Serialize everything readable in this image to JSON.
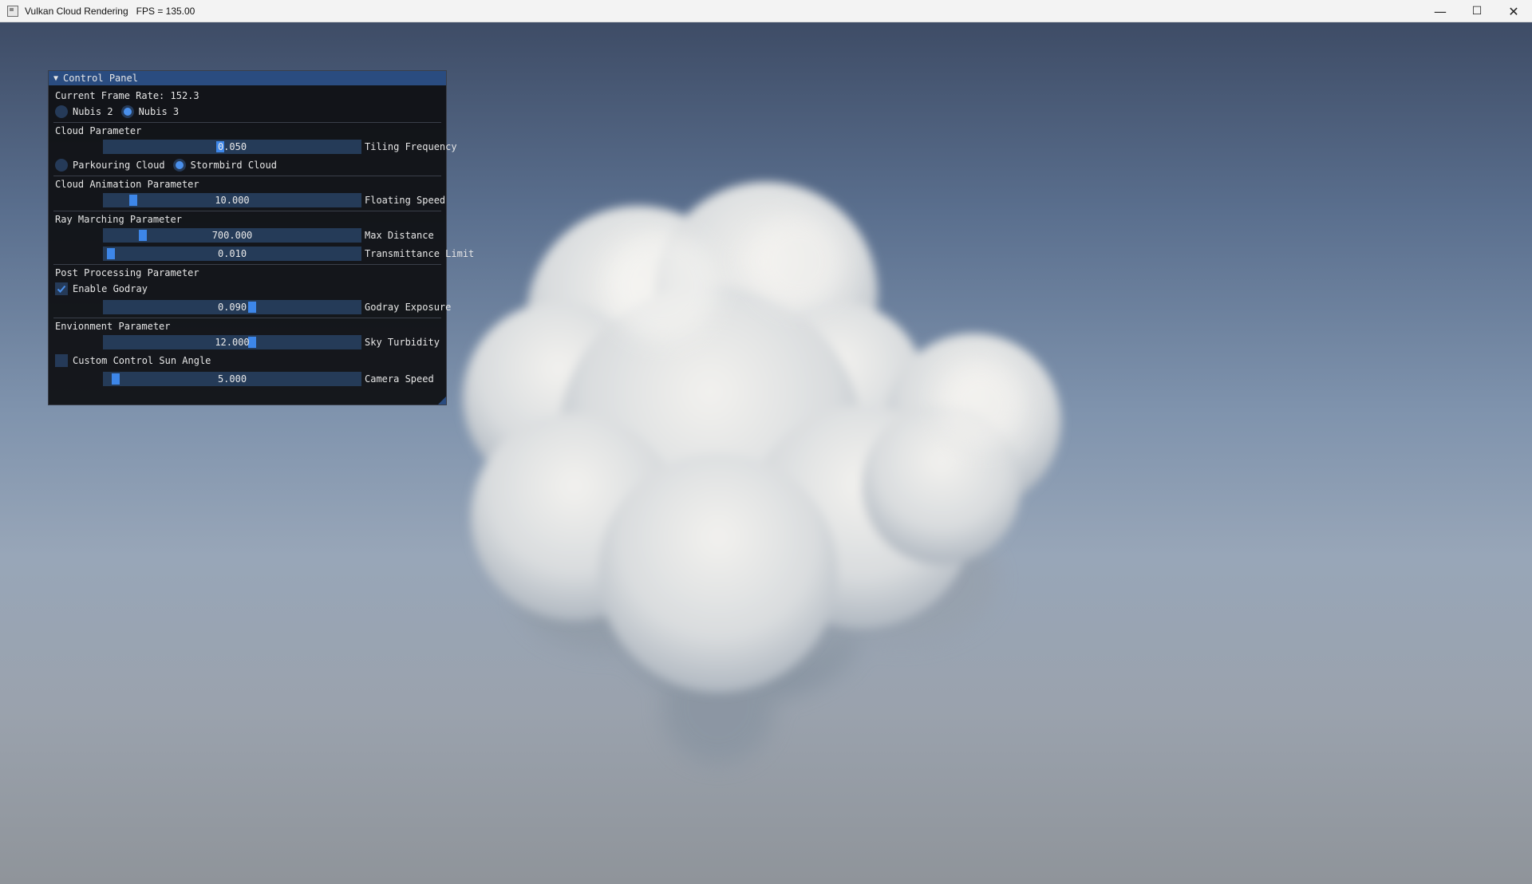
{
  "window": {
    "title": "Vulkan Cloud Rendering   FPS = 135.00",
    "minimize": "—",
    "maximize": "☐",
    "close": "✕"
  },
  "panel": {
    "header": "Control Panel",
    "collapse_icon": "▼",
    "frame_rate": "Current Frame Rate: 152.3",
    "nubis": {
      "options": [
        "Nubis 2",
        "Nubis 3"
      ],
      "selected": "Nubis 3"
    },
    "cloud_section": "Cloud Parameter",
    "tiling_frequency": {
      "value": "0.050",
      "label": "Tiling Frequency",
      "fraction": 0.45
    },
    "cloud_type": {
      "options": [
        "Parkouring Cloud",
        "Stormbird Cloud"
      ],
      "selected": "Stormbird Cloud"
    },
    "animation_section": "Cloud Animation Parameter",
    "floating_speed": {
      "value": "10.000",
      "label": "Floating Speed",
      "fraction": 0.1
    },
    "raymarch_section": "Ray Marching Parameter",
    "max_distance": {
      "value": "700.000",
      "label": "Max Distance",
      "fraction": 0.14
    },
    "transmittance_limit": {
      "value": "0.010",
      "label": "Transmittance Limit",
      "fraction": 0.01
    },
    "post_section": "Post Processing Parameter",
    "enable_godray": {
      "label": "Enable Godray",
      "checked": true
    },
    "godray_exposure": {
      "value": "0.090",
      "label": "Godray Exposure",
      "fraction": 0.58
    },
    "environment_section": "Envionment Parameter",
    "sky_turbidity": {
      "value": "12.000",
      "label": "Sky Turbidity",
      "fraction": 0.58
    },
    "custom_sun": {
      "label": "Custom Control Sun Angle",
      "checked": false
    },
    "camera_speed": {
      "value": "5.000",
      "label": "Camera Speed",
      "fraction": 0.03
    }
  },
  "colors": {
    "panel_header": "#2a4c80",
    "slider_bg": "#253b58",
    "slider_grab": "#3d86e8",
    "radio_on": "#4a90ec"
  }
}
